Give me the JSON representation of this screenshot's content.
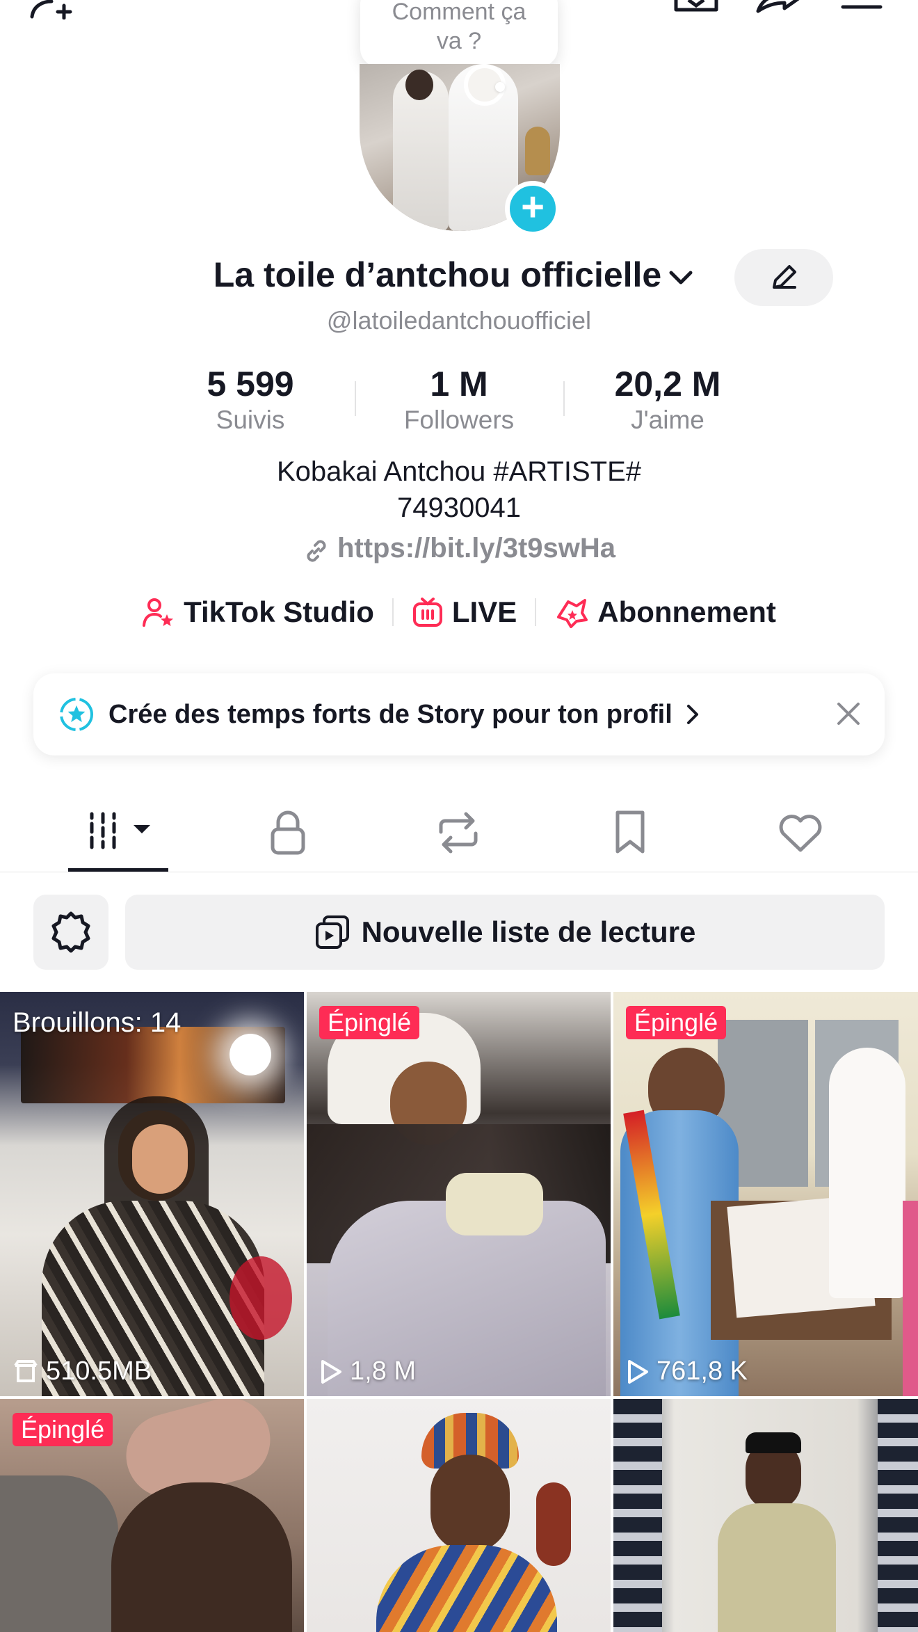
{
  "status_bubble": {
    "line1": "Comment ça",
    "line2": "va ?"
  },
  "profile": {
    "display_name": "La toile d’antchou officielle",
    "handle": "@latoiledantchouofficiel",
    "bio_line1": "Kobakai Antchou #ARTISTE#",
    "bio_line2": "74930041",
    "link": "https://bit.ly/3t9swHa"
  },
  "stats": [
    {
      "value": "5 599",
      "label": "Suivis"
    },
    {
      "value": "1 M",
      "label": "Followers"
    },
    {
      "value": "20,2 M",
      "label": "J'aime"
    }
  ],
  "tools": {
    "studio": "TikTok Studio",
    "live": "LIVE",
    "subscription": "Abonnement"
  },
  "story_prompt": "Crée des temps forts de Story pour ton profil",
  "playlist_button": "Nouvelle liste de lecture",
  "grid": {
    "drafts_label": "Brouillons: 14",
    "drafts_size": "510.5MB",
    "pinned_label": "Épinglé",
    "video2_views": "1,8 M",
    "video3_views": "761,8 K"
  },
  "colors": {
    "accent_pink": "#fe2c55",
    "accent_cyan": "#20c1e0",
    "text": "#161823",
    "muted": "#8a8b91"
  }
}
